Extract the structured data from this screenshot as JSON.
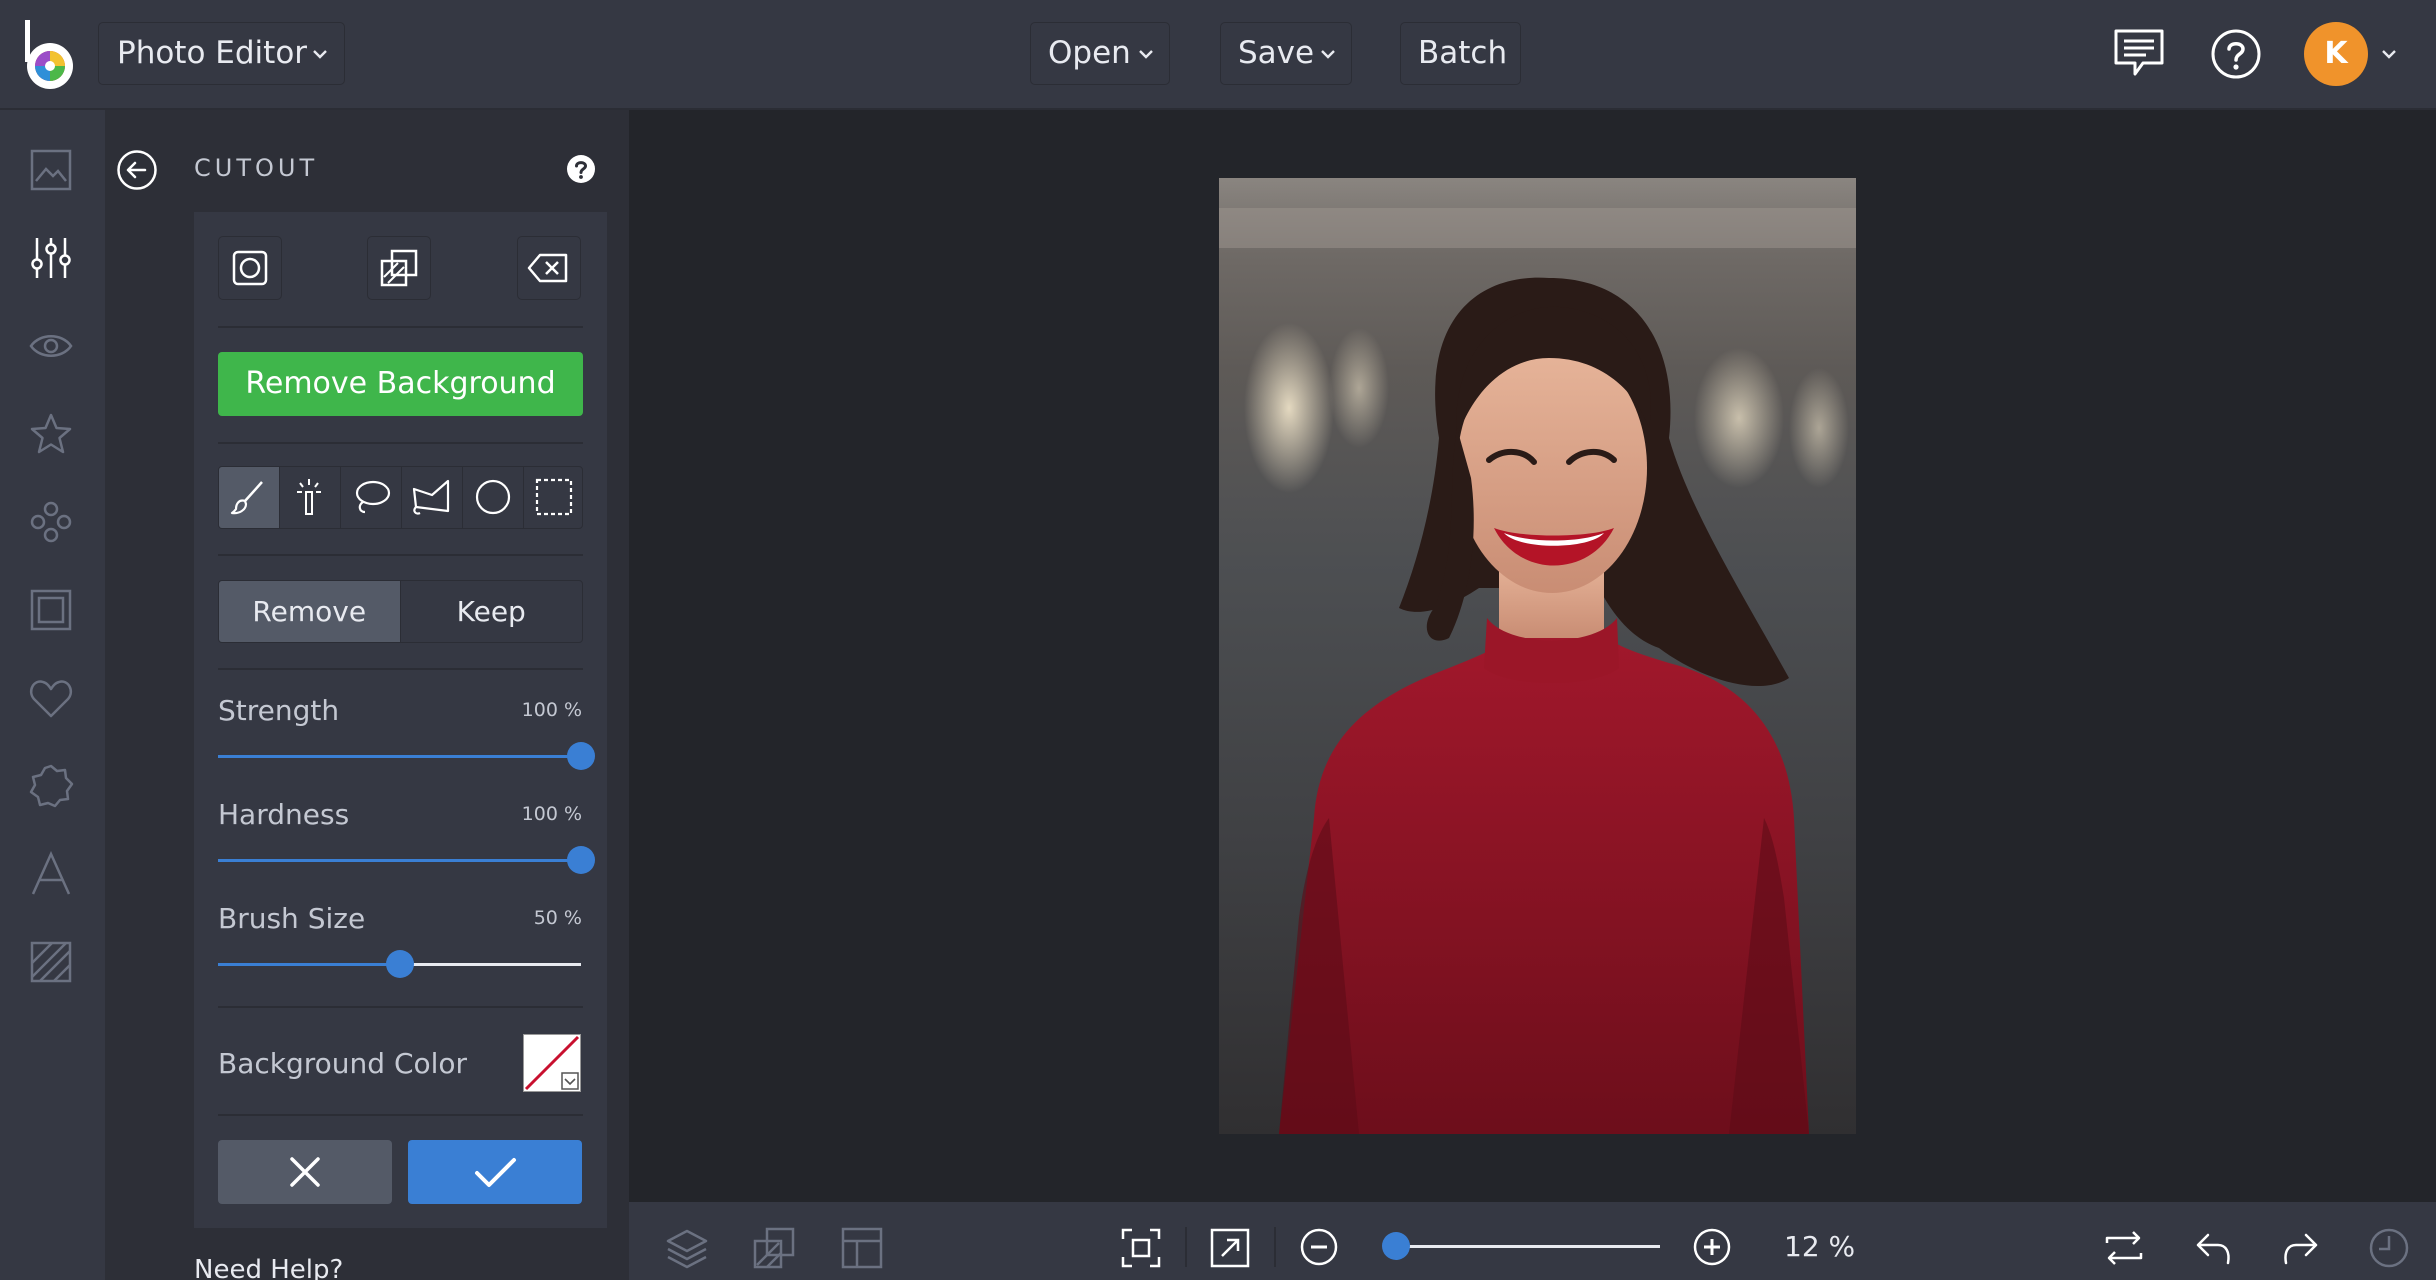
{
  "header": {
    "app_menu_label": "Photo Editor",
    "open_label": "Open",
    "save_label": "Save",
    "batch_label": "Batch",
    "avatar_initial": "K"
  },
  "rail": {
    "items": [
      "image-icon",
      "sliders-icon",
      "eye-icon",
      "star-icon",
      "shapes-icon",
      "frame-icon",
      "heart-icon",
      "badge-icon",
      "text-icon",
      "texture-icon"
    ],
    "active_index": 1
  },
  "panel": {
    "title": "CUTOUT",
    "mode_buttons": [
      "cutout-shape-icon",
      "overlay-icon",
      "eraser-icon"
    ],
    "remove_background_label": "Remove Background",
    "tools": [
      "brush-icon",
      "magic-wand-icon",
      "lasso-icon",
      "polygon-lasso-icon",
      "ellipse-select-icon",
      "rect-select-icon"
    ],
    "active_tool_index": 0,
    "toggle": {
      "remove_label": "Remove",
      "keep_label": "Keep",
      "active": "Remove"
    },
    "sliders": [
      {
        "label": "Strength",
        "value_text": "100 %",
        "value": 100
      },
      {
        "label": "Hardness",
        "value_text": "100 %",
        "value": 100
      },
      {
        "label": "Brush Size",
        "value_text": "50 %",
        "value": 50
      }
    ],
    "background_color_label": "Background Color",
    "need_help_label": "Need Help?"
  },
  "bottom": {
    "zoom_text": "12 %",
    "zoom_fraction": 0.03
  },
  "colors": {
    "accent": "#3a7fd4",
    "success": "#3fb64b",
    "avatar": "#f0932b"
  }
}
